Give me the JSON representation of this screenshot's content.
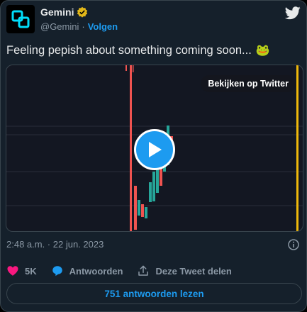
{
  "account": {
    "name": "Gemini",
    "handle": "@Gemini",
    "separator": "·",
    "follow_label": "Volgen"
  },
  "tweet": {
    "text": "Feeling pepish about something coming soon...",
    "emoji": "🐸",
    "media": {
      "view_on_twitter_label": "Bekijken op Twitter"
    },
    "timestamp": "2:48 a.m. · 22 jun. 2023"
  },
  "actions": {
    "like_count": "5K",
    "reply_label": "Antwoorden",
    "share_label": "Deze Tweet delen",
    "read_replies_label": "751 antwoorden lezen"
  },
  "colors": {
    "accent": "#1d9bf0",
    "like": "#f91880",
    "verified": "#e2b719",
    "candle_up": "#26a69a",
    "candle_down": "#ef5350",
    "highlight_line": "#f0b90b"
  },
  "icons": [
    "gemini-logo-icon",
    "verified-badge-icon",
    "twitter-bird-icon",
    "play-icon",
    "info-icon",
    "heart-icon",
    "reply-icon",
    "share-icon"
  ]
}
